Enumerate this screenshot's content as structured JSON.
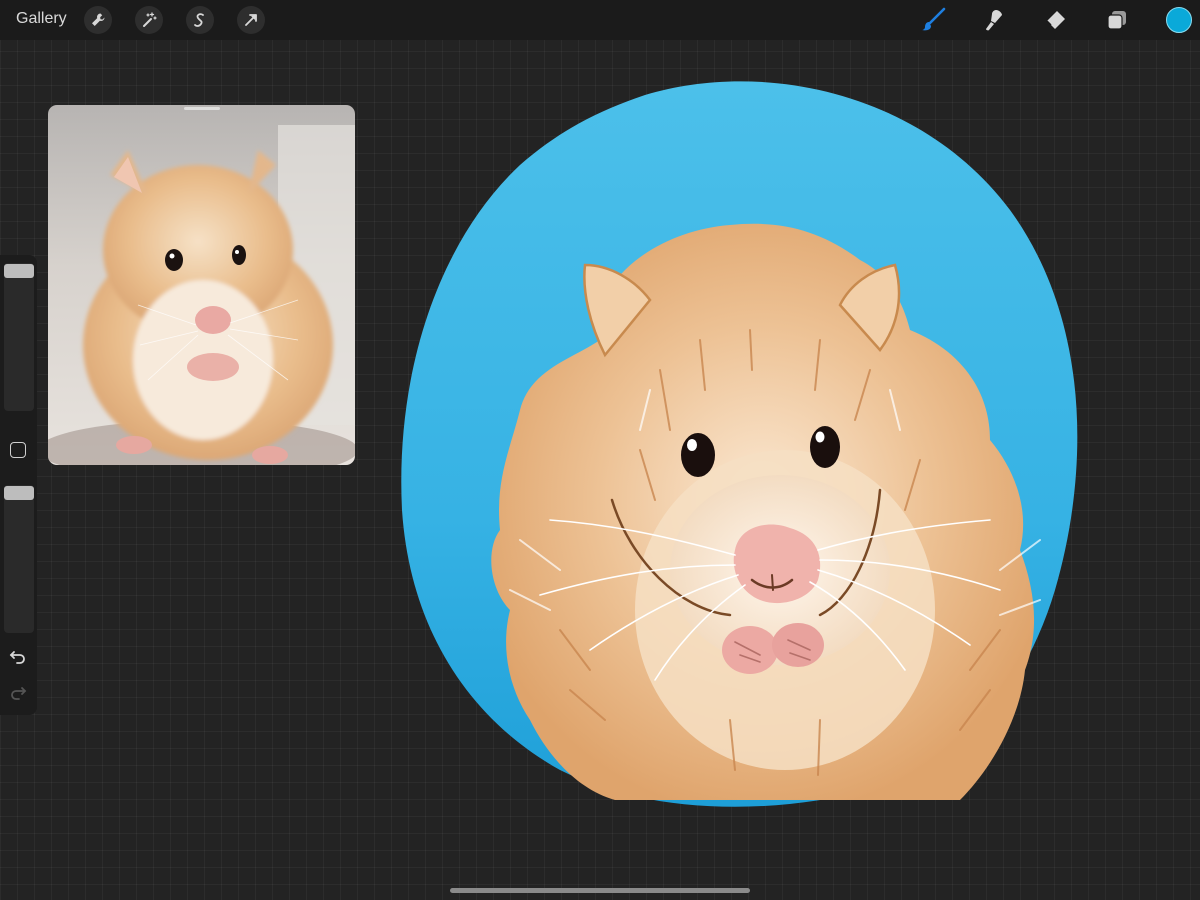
{
  "topbar": {
    "gallery_label": "Gallery",
    "left_tools": [
      "wrench-icon",
      "magic-wand-icon",
      "selection-icon",
      "transform-arrow-icon"
    ],
    "right_tools": [
      "brush-icon",
      "smudge-icon",
      "eraser-icon",
      "layers-icon"
    ],
    "active_tool": "brush-icon",
    "current_color": "#0aa9d9"
  },
  "reference": {
    "subject": "hamster-photo"
  },
  "sidebar": {
    "brush_size": 0.05,
    "brush_opacity": 0.05,
    "icons": [
      "modify-square-icon",
      "undo-icon",
      "redo-icon"
    ]
  },
  "canvas": {
    "subject": "hamster-painting",
    "background_color": "#3bb8e6",
    "fur_color": "#e9bb8a"
  },
  "colors": {
    "app_bg": "#232323",
    "topbar_bg": "#1b1b1b",
    "accent_blue": "#1e7fe0"
  }
}
